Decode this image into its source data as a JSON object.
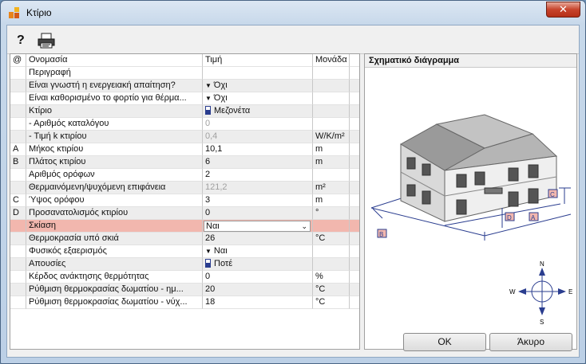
{
  "window": {
    "title": "Κτίριο",
    "close_label": "✕"
  },
  "toolbar": {
    "help_label": "?"
  },
  "grid": {
    "headers": {
      "mark": "@",
      "name": "Ονομασία",
      "value": "Τιμή",
      "unit": "Μονάδα"
    },
    "rows": [
      {
        "mark": "",
        "name": "Περιγραφή",
        "value": "",
        "unit": ""
      },
      {
        "mark": "",
        "name": "Είναι γνωστή η ενεργειακή απαίτηση?",
        "value": "Όχι",
        "unit": ""
      },
      {
        "mark": "",
        "name": "Είναι καθορισμένο το φορτίο για θέρμα...",
        "value": "Όχι",
        "unit": ""
      },
      {
        "mark": "",
        "name": "Κτίριο",
        "value": "Μεζονέτα",
        "unit": ""
      },
      {
        "mark": "",
        "name": "- Αριθμός καταλόγου",
        "value": "0",
        "unit": ""
      },
      {
        "mark": "",
        "name": "- Τιμή k κτιρίου",
        "value": "0,4",
        "unit": "W/K/m²"
      },
      {
        "mark": "A",
        "name": "Μήκος κτιρίου",
        "value": "10,1",
        "unit": "m"
      },
      {
        "mark": "B",
        "name": "Πλάτος κτιρίου",
        "value": "6",
        "unit": "m"
      },
      {
        "mark": "",
        "name": "Αριθμός ορόφων",
        "value": "2",
        "unit": ""
      },
      {
        "mark": "",
        "name": "Θερμαινόμενη/ψυχόμενη επιφάνεια",
        "value": "121,2",
        "unit": "m²"
      },
      {
        "mark": "C",
        "name": "Ύψος ορόφου",
        "value": "3",
        "unit": "m"
      },
      {
        "mark": "D",
        "name": "Προσανατολισμός κτιρίου",
        "value": "0",
        "unit": "°"
      },
      {
        "mark": "",
        "name": "Σκίαση",
        "value": "Ναι",
        "unit": ""
      },
      {
        "mark": "",
        "name": "Θερμοκρασία υπό σκιά",
        "value": "26",
        "unit": "°C"
      },
      {
        "mark": "",
        "name": "Φυσικός εξαερισμός",
        "value": "Ναι",
        "unit": ""
      },
      {
        "mark": "",
        "name": "Απουσίες",
        "value": "Ποτέ",
        "unit": ""
      },
      {
        "mark": "",
        "name": "Κέρδος ανάκτησης θερμότητας",
        "value": "0",
        "unit": "%"
      },
      {
        "mark": "",
        "name": "Ρύθμιση θερμοκρασίας δωματίου - ημ...",
        "value": "20",
        "unit": "°C"
      },
      {
        "mark": "",
        "name": "Ρύθμιση θερμοκρασίας δωματίου - νύχ...",
        "value": "18",
        "unit": "°C"
      }
    ]
  },
  "diagram": {
    "title": "Σχηματικό διάγραμμα",
    "labels": {
      "a": "A",
      "b": "B",
      "c": "C",
      "d": "D"
    },
    "compass": {
      "n": "N",
      "s": "S",
      "e": "E",
      "w": "W"
    }
  },
  "buttons": {
    "ok": "OK",
    "cancel": "Άκυρο"
  },
  "colors": {
    "selected_row": "#f2b7ae",
    "house_blue": "#2a3d8f"
  }
}
